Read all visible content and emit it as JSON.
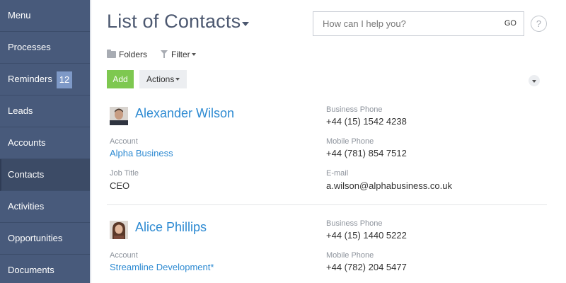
{
  "sidebar": {
    "items": [
      {
        "label": "Menu"
      },
      {
        "label": "Processes"
      },
      {
        "label": "Reminders",
        "badge": "12"
      },
      {
        "label": "Leads"
      },
      {
        "label": "Accounts"
      },
      {
        "label": "Contacts",
        "active": true
      },
      {
        "label": "Activities"
      },
      {
        "label": "Opportunities"
      },
      {
        "label": "Documents"
      }
    ]
  },
  "header": {
    "title": "List of Contacts",
    "search_placeholder": "How can I help you?",
    "search_go": "GO",
    "help": "?"
  },
  "toolbar": {
    "folders": "Folders",
    "filter": "Filter",
    "add": "Add",
    "actions": "Actions"
  },
  "contacts": [
    {
      "name": "Alexander Wilson",
      "account_label": "Account",
      "account": "Alpha Business",
      "job_title_label": "Job Title",
      "job_title": "CEO",
      "business_phone_label": "Business Phone",
      "business_phone": "+44 (15) 1542 4238",
      "mobile_phone_label": "Mobile Phone",
      "mobile_phone": "+44 (781) 854 7512",
      "email_label": "E-mail",
      "email": "a.wilson@alphabusiness.co.uk"
    },
    {
      "name": "Alice Phillips",
      "account_label": "Account",
      "account": "Streamline Development*",
      "business_phone_label": "Business Phone",
      "business_phone": "+44 (15) 1440 5222",
      "mobile_phone_label": "Mobile Phone",
      "mobile_phone": "+44 (782) 204 5477"
    }
  ],
  "colors": {
    "sidebar_bg": "#485a7b",
    "active_item_bg": "#3c4b66",
    "badge_bg": "#7e99c7",
    "link": "#2d8ad2",
    "add_button": "#7ec850",
    "title": "#4c5870"
  }
}
